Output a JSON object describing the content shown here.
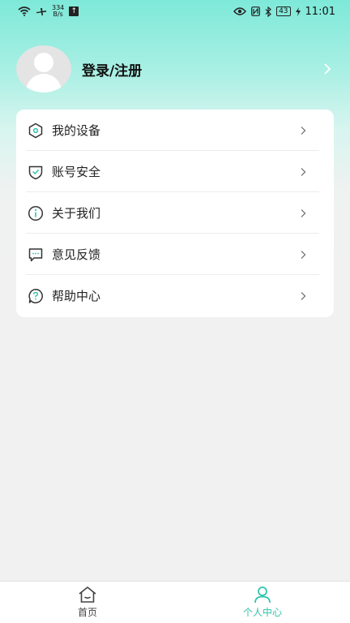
{
  "status_bar": {
    "net_speed_value": "334",
    "net_speed_unit": "B/s",
    "battery": "43",
    "time": "11:01",
    "icons": [
      "wifi-icon",
      "airplane-icon",
      "upload-icon",
      "eye-icon",
      "nfc-icon",
      "bluetooth-icon",
      "battery-icon",
      "charging-icon"
    ]
  },
  "profile": {
    "login_label": "登录/注册"
  },
  "menu": {
    "items": [
      {
        "label": "我的设备",
        "icon": "device-icon"
      },
      {
        "label": "账号安全",
        "icon": "shield-check-icon"
      },
      {
        "label": "关于我们",
        "icon": "info-icon"
      },
      {
        "label": "意见反馈",
        "icon": "feedback-icon"
      },
      {
        "label": "帮助中心",
        "icon": "help-icon"
      }
    ]
  },
  "tabbar": {
    "home_label": "首页",
    "me_label": "个人中心"
  },
  "colors": {
    "accent": "#2ec3ac",
    "header_gradient_top": "#7ee9d9"
  }
}
